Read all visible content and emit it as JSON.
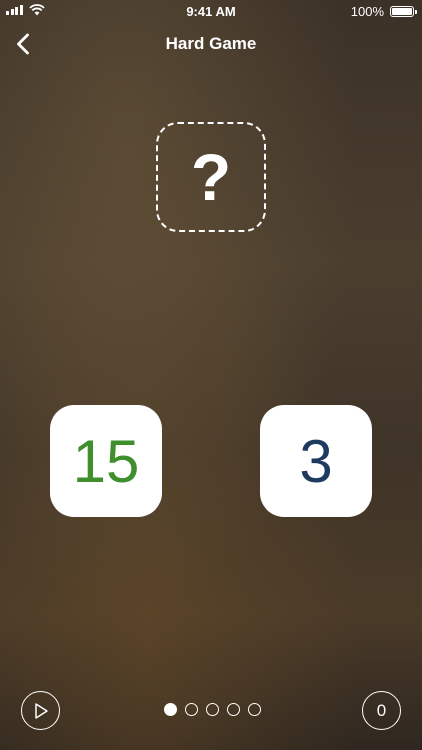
{
  "status_bar": {
    "time": "9:41 AM",
    "battery_text": "100%",
    "battery_level": 1.0,
    "icons": [
      "cellular-signal-icon",
      "wifi-icon",
      "battery-icon"
    ]
  },
  "nav": {
    "title": "Hard Game",
    "back_icon": "chevron-left-icon"
  },
  "answer_slot": {
    "symbol": "?"
  },
  "tiles": [
    {
      "value": "15",
      "color": "#3f8f2c"
    },
    {
      "value": "3",
      "color": "#1f3a5f"
    }
  ],
  "footer": {
    "play_icon": "play-icon",
    "page_count": 5,
    "active_page": 1,
    "score": "0"
  },
  "colors": {
    "foreground": "#ffffff",
    "tile_background": "#ffffff"
  }
}
